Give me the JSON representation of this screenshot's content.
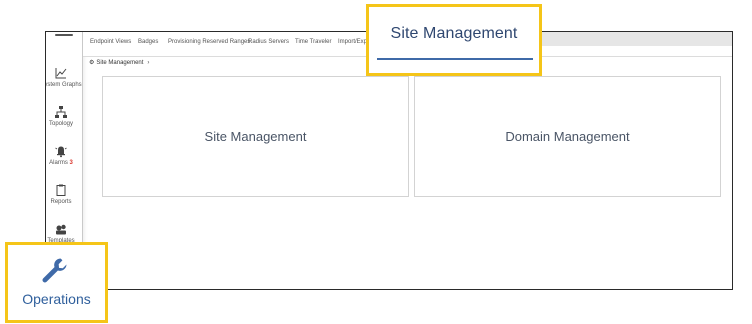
{
  "sidebar": {
    "items": [
      {
        "label": "System Graphs",
        "icon": "graph-icon"
      },
      {
        "label": "Topology",
        "icon": "topology-icon"
      },
      {
        "label": "Alarms",
        "count": "3",
        "icon": "alarm-bell-icon"
      },
      {
        "label": "Reports",
        "icon": "clipboard-icon"
      },
      {
        "label": "Templates",
        "icon": "templates-icon"
      }
    ]
  },
  "tabs": [
    {
      "label": "Endpoint Views"
    },
    {
      "label": "Badges"
    },
    {
      "label": "Provisioning Reserved Ranges"
    },
    {
      "label": "Radius Servers"
    },
    {
      "label": "Time Traveler"
    },
    {
      "label": "Import/Export"
    }
  ],
  "breadcrumb": {
    "label": "Site Management",
    "icon": "gear-icon"
  },
  "cards": [
    {
      "label": "Site Management"
    },
    {
      "label": "Domain Management"
    }
  ],
  "callouts": {
    "site_tab": {
      "label": "Site Management"
    },
    "operations": {
      "label": "Operations",
      "icon": "wrench-icon"
    }
  },
  "colors": {
    "highlight": "#f5c518",
    "accent": "#3f6aa8",
    "alarm": "#d9342b"
  }
}
